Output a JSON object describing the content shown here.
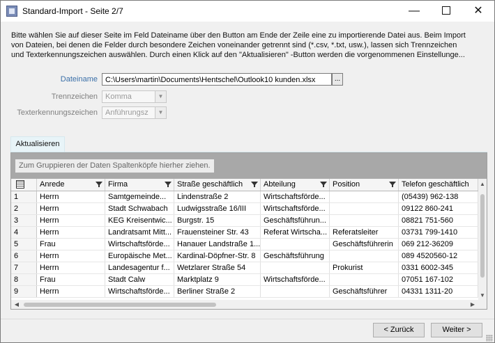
{
  "window": {
    "title": "Standard-Import - Seite 2/7",
    "minimize_glyph": "—",
    "close_glyph": "✕"
  },
  "intro_lines": [
    "Bitte wählen Sie auf dieser Seite im Feld Dateiname über den Button am Ende der Zeile eine zu importierende Datei aus. Beim Import",
    "von Dateien, bei denen die Felder durch besondere Zeichen voneinander getrennt sind (*.csv, *.txt, usw.), lassen sich Trennzeichen",
    "und Texterkennungszeichen auswählen. Durch einen Klick auf den \"Aktualisieren\" -Button werden die vorgenommenen Einstellunge..."
  ],
  "fields": {
    "dateiname_label": "Dateiname",
    "dateiname_value": "C:\\Users\\martin\\Documents\\Hentschel\\Outlook10 kunden.xlsx",
    "browse_label": "...",
    "trennzeichen_label": "Trennzeichen",
    "trennzeichen_value": "Komma",
    "texterkennung_label": "Texterkennungszeichen",
    "texterkennung_value": "Anführungsz"
  },
  "tab": {
    "label": "Aktualisieren"
  },
  "grid": {
    "group_hint": "Zum Gruppieren der Daten Spaltenköpfe hierher ziehen.",
    "columns": [
      "Anrede",
      "Firma",
      "Straße geschäftlich",
      "Abteilung",
      "Position",
      "Telefon geschäftlich"
    ],
    "rows": [
      [
        "1",
        "Herrn",
        "Samtgemeinde...",
        "Lindenstraße 2",
        "Wirtschaftsförde...",
        "",
        "(05439) 962-138"
      ],
      [
        "2",
        "Herrn",
        "Stadt Schwabach",
        "Ludwigsstraße 16/III",
        "Wirtschaftsförde...",
        "",
        "09122 860-241"
      ],
      [
        "3",
        "Herrn",
        "KEG Kreisentwic...",
        "Burgstr. 15",
        "Geschäftsführun...",
        "",
        "08821 751-560"
      ],
      [
        "4",
        "Herrn",
        "Landratsamt Mitt...",
        "Frauensteiner Str. 43",
        "Referat Wirtscha...",
        "Referatsleiter",
        "03731 799-1410"
      ],
      [
        "5",
        "Frau",
        "Wirtschaftsförde...",
        "Hanauer Landstraße 1...",
        "",
        "Geschäftsführerin",
        "069 212-36209"
      ],
      [
        "6",
        "Herrn",
        "Europäische Met...",
        "Kardinal-Döpfner-Str. 8",
        "Geschäftsführung",
        "",
        "089 4520560-12"
      ],
      [
        "7",
        "Herrn",
        "Landesagentur f...",
        "Wetzlarer Straße 54",
        "",
        "Prokurist",
        "0331 6002-345"
      ],
      [
        "8",
        "Frau",
        "Stadt Calw",
        "Marktplatz 9",
        "Wirtschaftsförde...",
        "",
        "07051 167-102"
      ],
      [
        "9",
        "Herrn",
        "Wirtschaftsförde...",
        "Berliner Straße 2",
        "",
        "Geschäftsführer",
        "04331 1311-20"
      ]
    ]
  },
  "footer": {
    "back_label": "< Zurück",
    "next_label": "Weiter >"
  }
}
